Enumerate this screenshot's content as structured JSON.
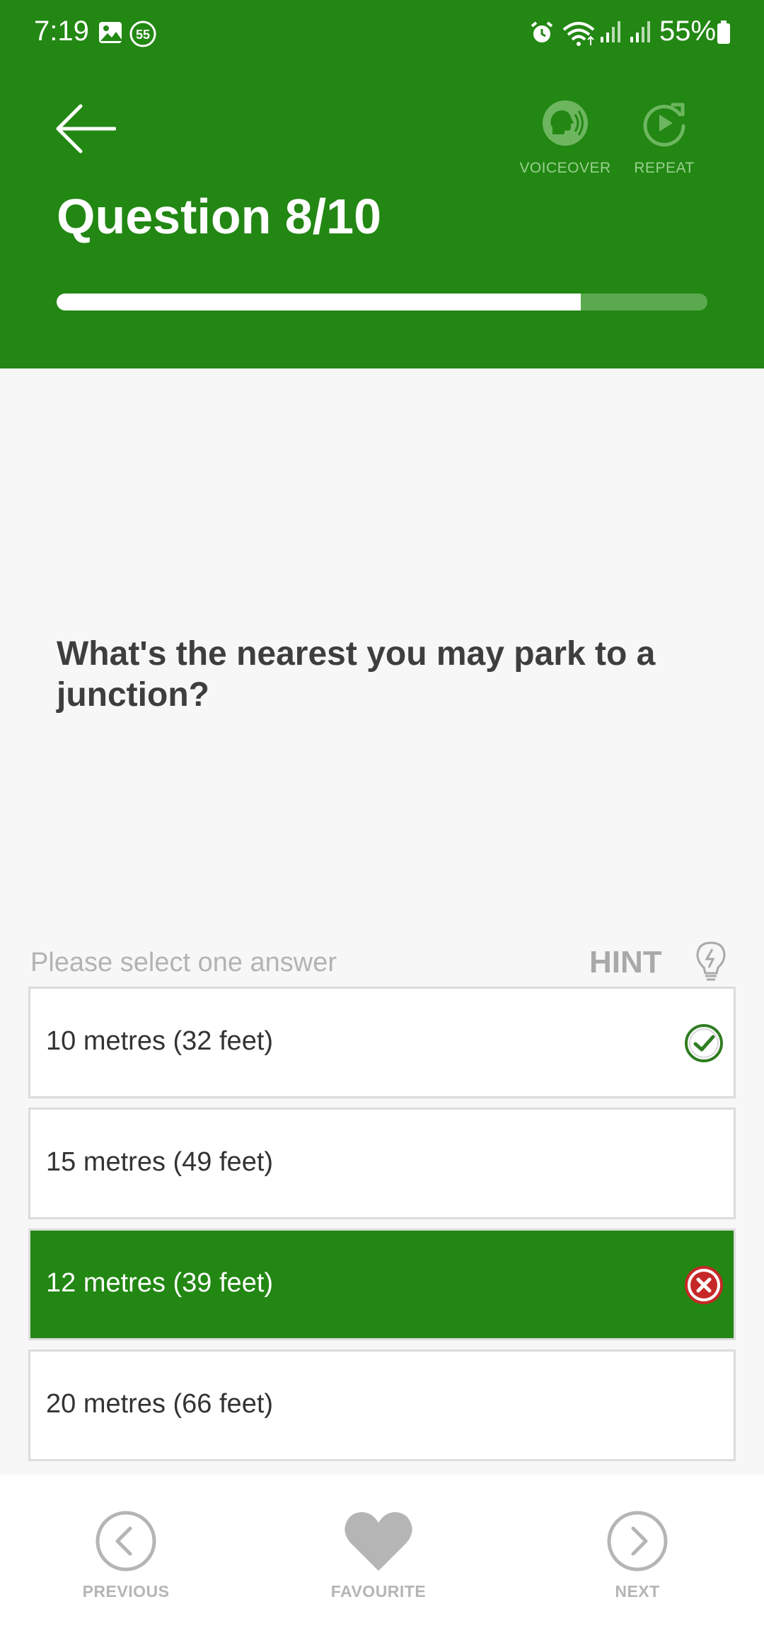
{
  "status": {
    "time": "7:19",
    "notification_badge": "55",
    "battery": "55%"
  },
  "header": {
    "title": "Question 8/10",
    "voiceover_label": "VOICEOVER",
    "repeat_label": "REPEAT",
    "progress_fraction": 0.805
  },
  "question": {
    "text": "What's the nearest you may park to a junction?"
  },
  "answers_section": {
    "prompt": "Please select one answer",
    "hint_label": "HINT"
  },
  "answers": [
    {
      "text": "10 metres (32 feet)",
      "state": "correct"
    },
    {
      "text": "15 metres (49 feet)",
      "state": "none"
    },
    {
      "text": "12 metres (39 feet)",
      "state": "selected-wrong"
    },
    {
      "text": "20 metres (66 feet)",
      "state": "none"
    }
  ],
  "bottom_nav": {
    "previous_label": "PREVIOUS",
    "favourite_label": "FAVOURITE",
    "next_label": "NEXT"
  },
  "colors": {
    "brand_green": "#228713",
    "correct_green": "#2f7d21",
    "wrong_red": "#c62828",
    "muted_gray": "#b5b5b5"
  }
}
